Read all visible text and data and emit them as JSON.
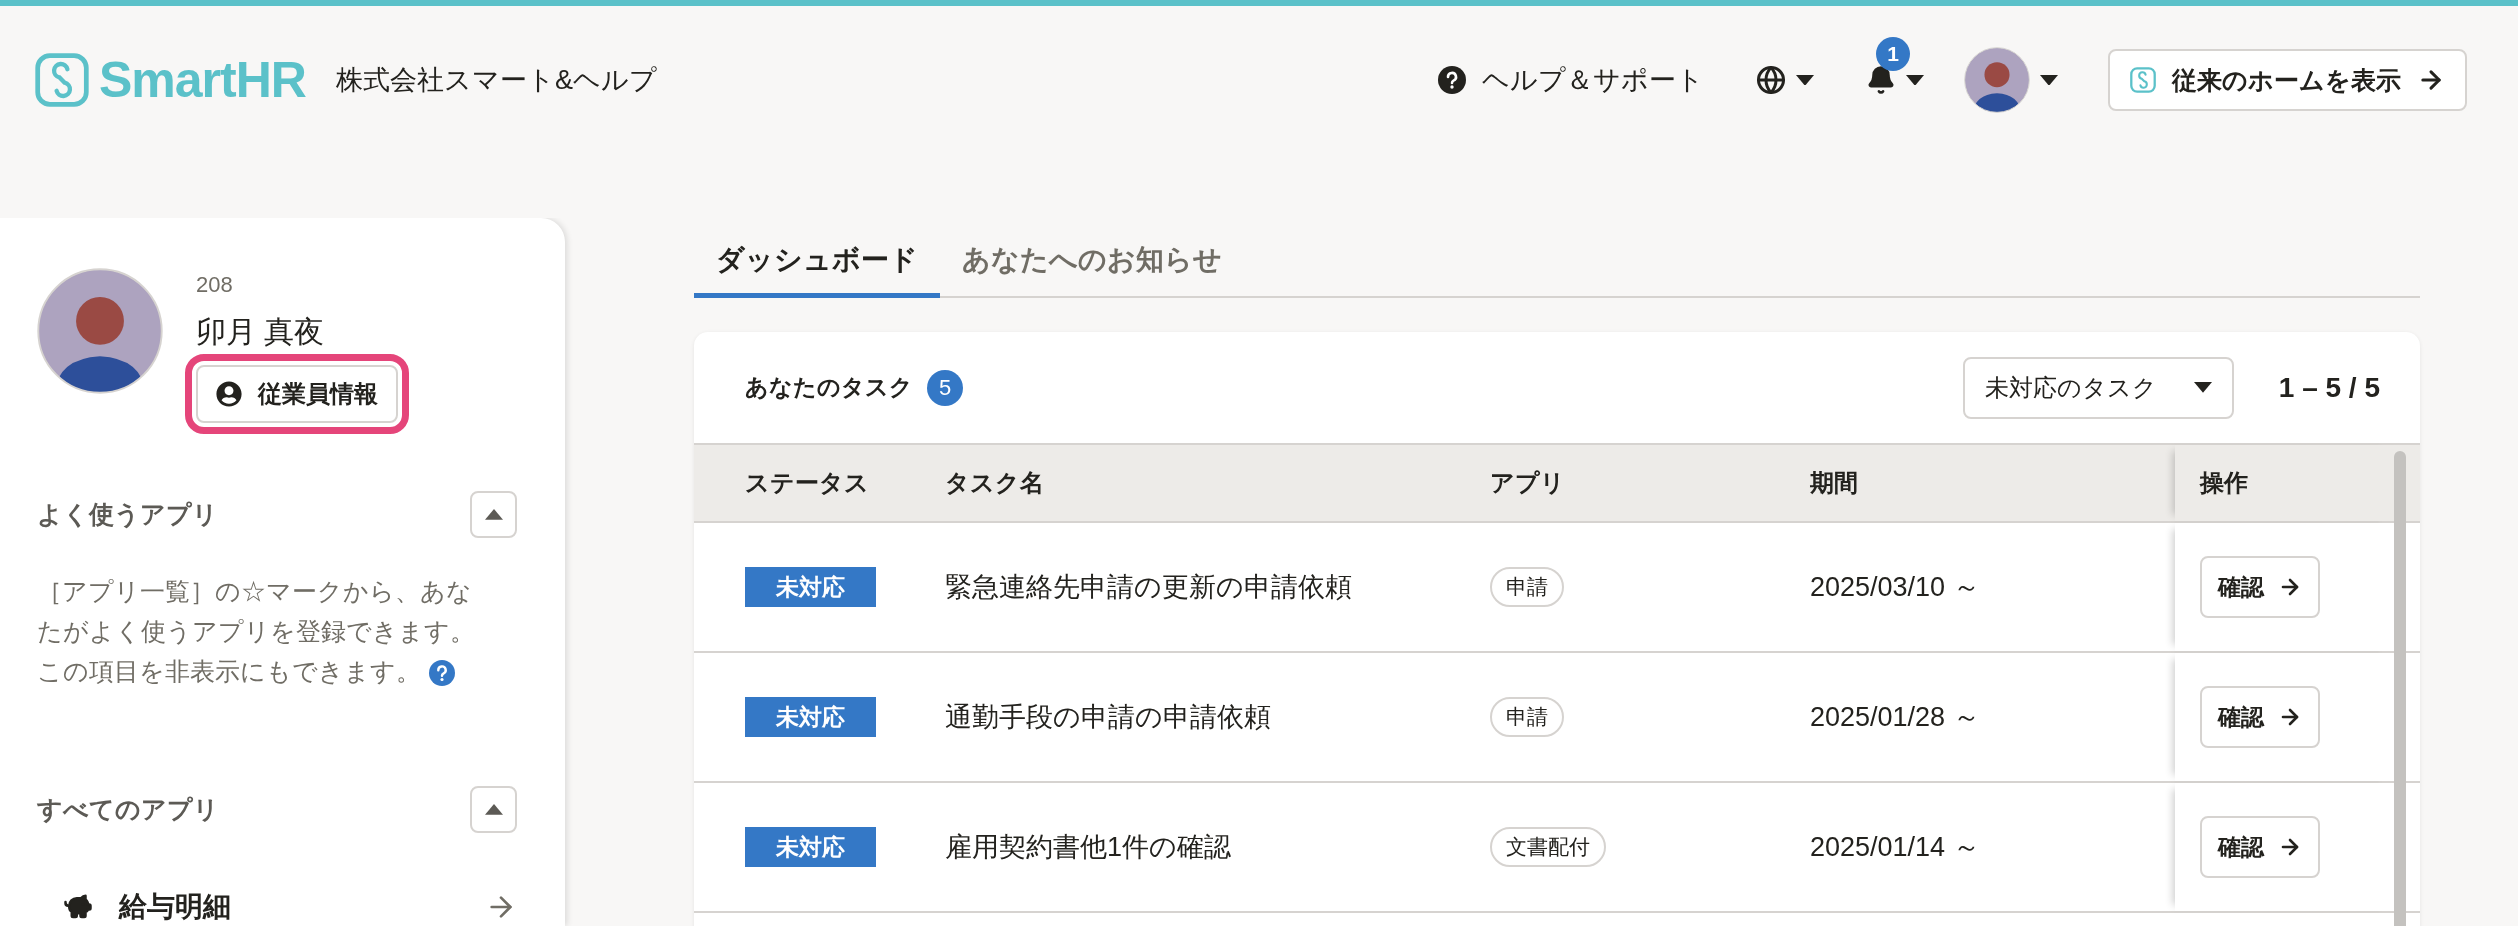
{
  "header": {
    "logo_text": "SmartHR",
    "company": "株式会社スマート&ヘルプ",
    "help": "ヘルプ＆サポート",
    "notification_count": "1",
    "classic_home_button": "従来のホームを表示"
  },
  "profile": {
    "employee_number": "208",
    "name": "卯月 真夜",
    "info_button": "従業員情報",
    "info_button_focused": true
  },
  "sections": [
    {
      "title": "よく使うアプリ",
      "expanded": true,
      "description": "［アプリ一覧］の☆マークから、あなたがよく使うアプリを登録できます。この項目を非表示にもできます。"
    },
    {
      "title": "すべてのアプリ",
      "expanded": true,
      "apps": [
        {
          "label": "給与明細"
        }
      ]
    }
  ],
  "tabs": [
    {
      "label": "ダッシュボード",
      "selected": true
    },
    {
      "label": "あなたへのお知らせ",
      "selected": false
    }
  ],
  "tasks": {
    "title": "あなたのタスク",
    "count": "5",
    "filter": "未対応のタスク",
    "range": "1 – 5 / 5",
    "columns": [
      "ステータス",
      "タスク名",
      "アプリ",
      "期間",
      "操作"
    ],
    "rows": [
      {
        "status": "未対応",
        "name": "緊急連絡先申請の更新の申請依頼",
        "app": "申請",
        "period": "2025/03/10 ～",
        "action": "確認"
      },
      {
        "status": "未対応",
        "name": "通勤手段の申請の申請依頼",
        "app": "申請",
        "period": "2025/01/28 ～",
        "action": "確認"
      },
      {
        "status": "未対応",
        "name": "雇用契約書他1件の確認",
        "app": "文書配付",
        "period": "2025/01/14 ～",
        "action": "確認"
      }
    ]
  }
}
